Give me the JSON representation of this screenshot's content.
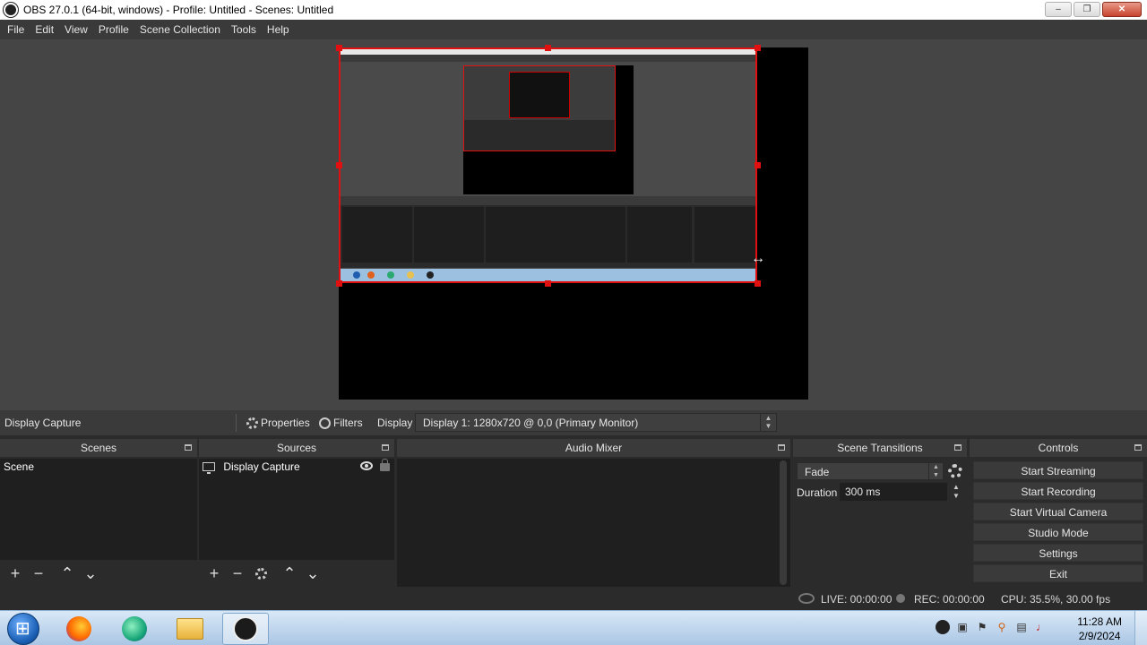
{
  "window": {
    "title": "OBS 27.0.1 (64-bit, windows) - Profile: Untitled - Scenes: Untitled",
    "controls": [
      "minimize",
      "maximize",
      "close"
    ]
  },
  "menu": [
    "File",
    "Edit",
    "View",
    "Profile",
    "Scene Collection",
    "Tools",
    "Help"
  ],
  "source_toolbar": {
    "source_name": "Display Capture",
    "properties_label": "Properties",
    "filters_label": "Filters",
    "display_label": "Display",
    "display_value": "Display 1: 1280x720 @ 0,0 (Primary Monitor)"
  },
  "docks": {
    "scenes": {
      "title": "Scenes",
      "items": [
        "Scene"
      ]
    },
    "sources": {
      "title": "Sources",
      "items": [
        "Display Capture"
      ]
    },
    "audio_mixer": {
      "title": "Audio Mixer"
    },
    "transitions": {
      "title": "Scene Transitions",
      "selected": "Fade",
      "duration_label": "Duration",
      "duration_value": "300 ms"
    },
    "controls": {
      "title": "Controls",
      "buttons": [
        "Start Streaming",
        "Start Recording",
        "Start Virtual Camera",
        "Studio Mode",
        "Settings",
        "Exit"
      ]
    }
  },
  "status": {
    "live": "LIVE: 00:00:00",
    "rec": "REC: 00:00:00",
    "cpu": "CPU: 35.5%, 30.00 fps"
  },
  "taskbar": {
    "apps": [
      "firefox-icon",
      "app-icon",
      "file-explorer-icon",
      "obs-icon"
    ],
    "time": "11:28 AM",
    "date": "2/9/2024"
  },
  "colors": {
    "selection": "#e01010",
    "panel": "#2b2b2b",
    "header": "#3a3a3a"
  }
}
